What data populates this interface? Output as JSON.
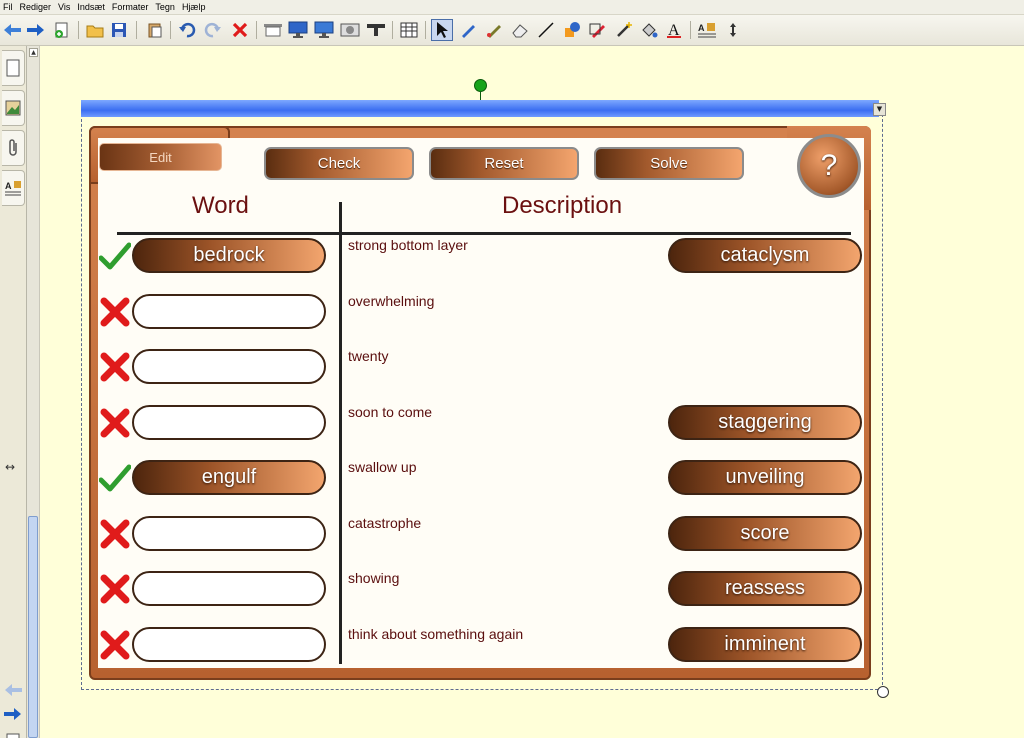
{
  "menu": [
    "Fil",
    "Rediger",
    "Vis",
    "Indsæt",
    "Formater",
    "Tegn",
    "Hjælp"
  ],
  "toolbar": {
    "icons": [
      "back-arrow-icon",
      "forward-arrow-icon",
      "new-page-icon",
      "open-folder-icon",
      "save-icon",
      "paste-icon",
      "undo-icon",
      "redo-icon",
      "delete-icon",
      "screen-shade-icon",
      "display-icon",
      "dual-display-icon",
      "camera-icon",
      "toolbar-icon",
      "table-icon",
      "select-arrow-icon",
      "pen-icon",
      "creative-pen-icon",
      "eraser-icon",
      "line-icon",
      "shapes-icon",
      "fill-icon",
      "magic-pen-icon",
      "fill-bucket-icon",
      "text-icon",
      "properties-icon",
      "move-toolbar-icon"
    ]
  },
  "activity": {
    "edit_label": "Edit",
    "check_label": "Check",
    "reset_label": "Reset",
    "solve_label": "Solve",
    "help_label": "?",
    "word_header": "Word",
    "description_header": "Description",
    "rows": [
      {
        "status": "correct",
        "word": "bedrock",
        "description": "strong bottom layer",
        "choice": "cataclysm"
      },
      {
        "status": "wrong",
        "word": "",
        "description": "overwhelming",
        "choice": ""
      },
      {
        "status": "wrong",
        "word": "",
        "description": "twenty",
        "choice": ""
      },
      {
        "status": "wrong",
        "word": "",
        "description": "soon to come",
        "choice": "staggering"
      },
      {
        "status": "correct",
        "word": "engulf",
        "description": "swallow up",
        "choice": "unveiling"
      },
      {
        "status": "wrong",
        "word": "",
        "description": "catastrophe",
        "choice": "score"
      },
      {
        "status": "wrong",
        "word": "",
        "description": "showing",
        "choice": "reassess"
      },
      {
        "status": "wrong",
        "word": "",
        "description": "think about something again",
        "choice": "imminent"
      }
    ]
  },
  "colors": {
    "canvas_bg": "#ffffd9",
    "frame_brown": "#b7612f",
    "text_maroon": "#6b1010",
    "check_green": "#2f9e2f",
    "cross_red": "#e01b1b"
  }
}
